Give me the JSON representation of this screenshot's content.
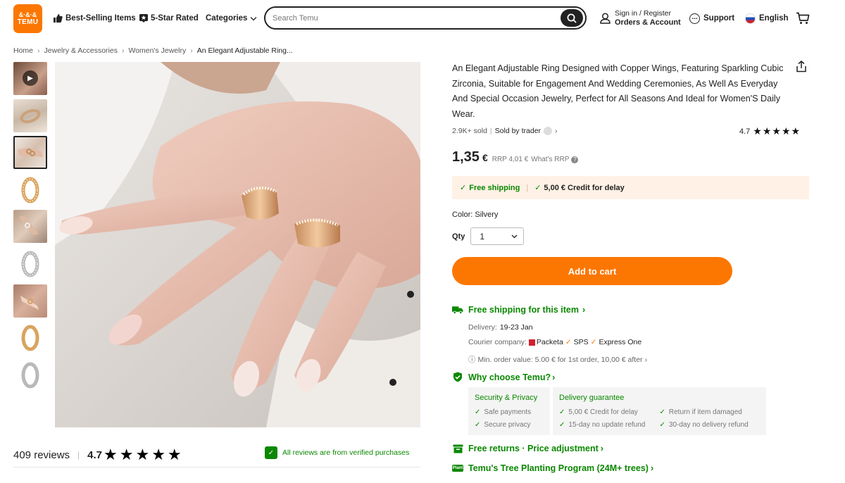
{
  "header": {
    "logo_top": "&·&·&",
    "logo_bottom": "TEMU",
    "nav": [
      "Best-Selling Items",
      "5-Star Rated",
      "Categories"
    ],
    "search_placeholder": "Search Temu",
    "signin_line1": "Sign in / Register",
    "signin_line2": "Orders & Account",
    "support": "Support",
    "language": "English"
  },
  "breadcrumb": [
    "Home",
    "Jewelry & Accessories",
    "Women's Jewelry",
    "An Elegant Adjustable Ring..."
  ],
  "product": {
    "title": "An Elegant Adjustable Ring Designed with Copper Wings, Featuring Sparkling Cubic Zirconia, Suitable for Engagement And Wedding Ceremonies, As Well As Everyday And Special Occasion Jewelry, Perfect for All Seasons And Ideal for Women'S Daily Wear.",
    "sold": "2.9K+ sold",
    "sold_by": "Sold by trader",
    "rating": "4.7",
    "price_main": "1,35",
    "price_currency": "€",
    "rrp": "RRP 4,01 €",
    "whats_rrp": "What's RRP",
    "promo_shipping": "Free shipping",
    "promo_credit": "5,00 € Credit for delay",
    "color_label": "Color: Silvery",
    "qty_label": "Qty",
    "qty_value": "1",
    "add_to_cart": "Add to cart"
  },
  "shipping": {
    "heading": "Free shipping for this item",
    "delivery_label": "Delivery:",
    "delivery_value": "19-23 Jan",
    "courier_label": "Courier company:",
    "courier_1": "Packeta",
    "courier_2": "SPS",
    "courier_3": "Express One",
    "min_order": "Min. order value: 5.00 € for 1st order, 10,00 € after"
  },
  "why": {
    "heading": "Why choose Temu?",
    "security_title": "Security & Privacy",
    "security_items": [
      "Safe payments",
      "Secure privacy"
    ],
    "delivery_title": "Delivery guarantee",
    "delivery_items": [
      "5,00 € Credit for delay",
      "15-day no update refund",
      "Return if item damaged",
      "30-day no delivery refund"
    ]
  },
  "returns_heading": "Free returns · Price adjustment",
  "tree_heading": "Temu's Tree Planting Program (24M+ trees)",
  "tree_icon_text": "Plant",
  "reviews": {
    "count": "409 reviews",
    "rating": "4.7",
    "verified": "All reviews are from verified purchases"
  },
  "colors": {
    "accent": "#fb7701",
    "green": "#0a8800"
  }
}
